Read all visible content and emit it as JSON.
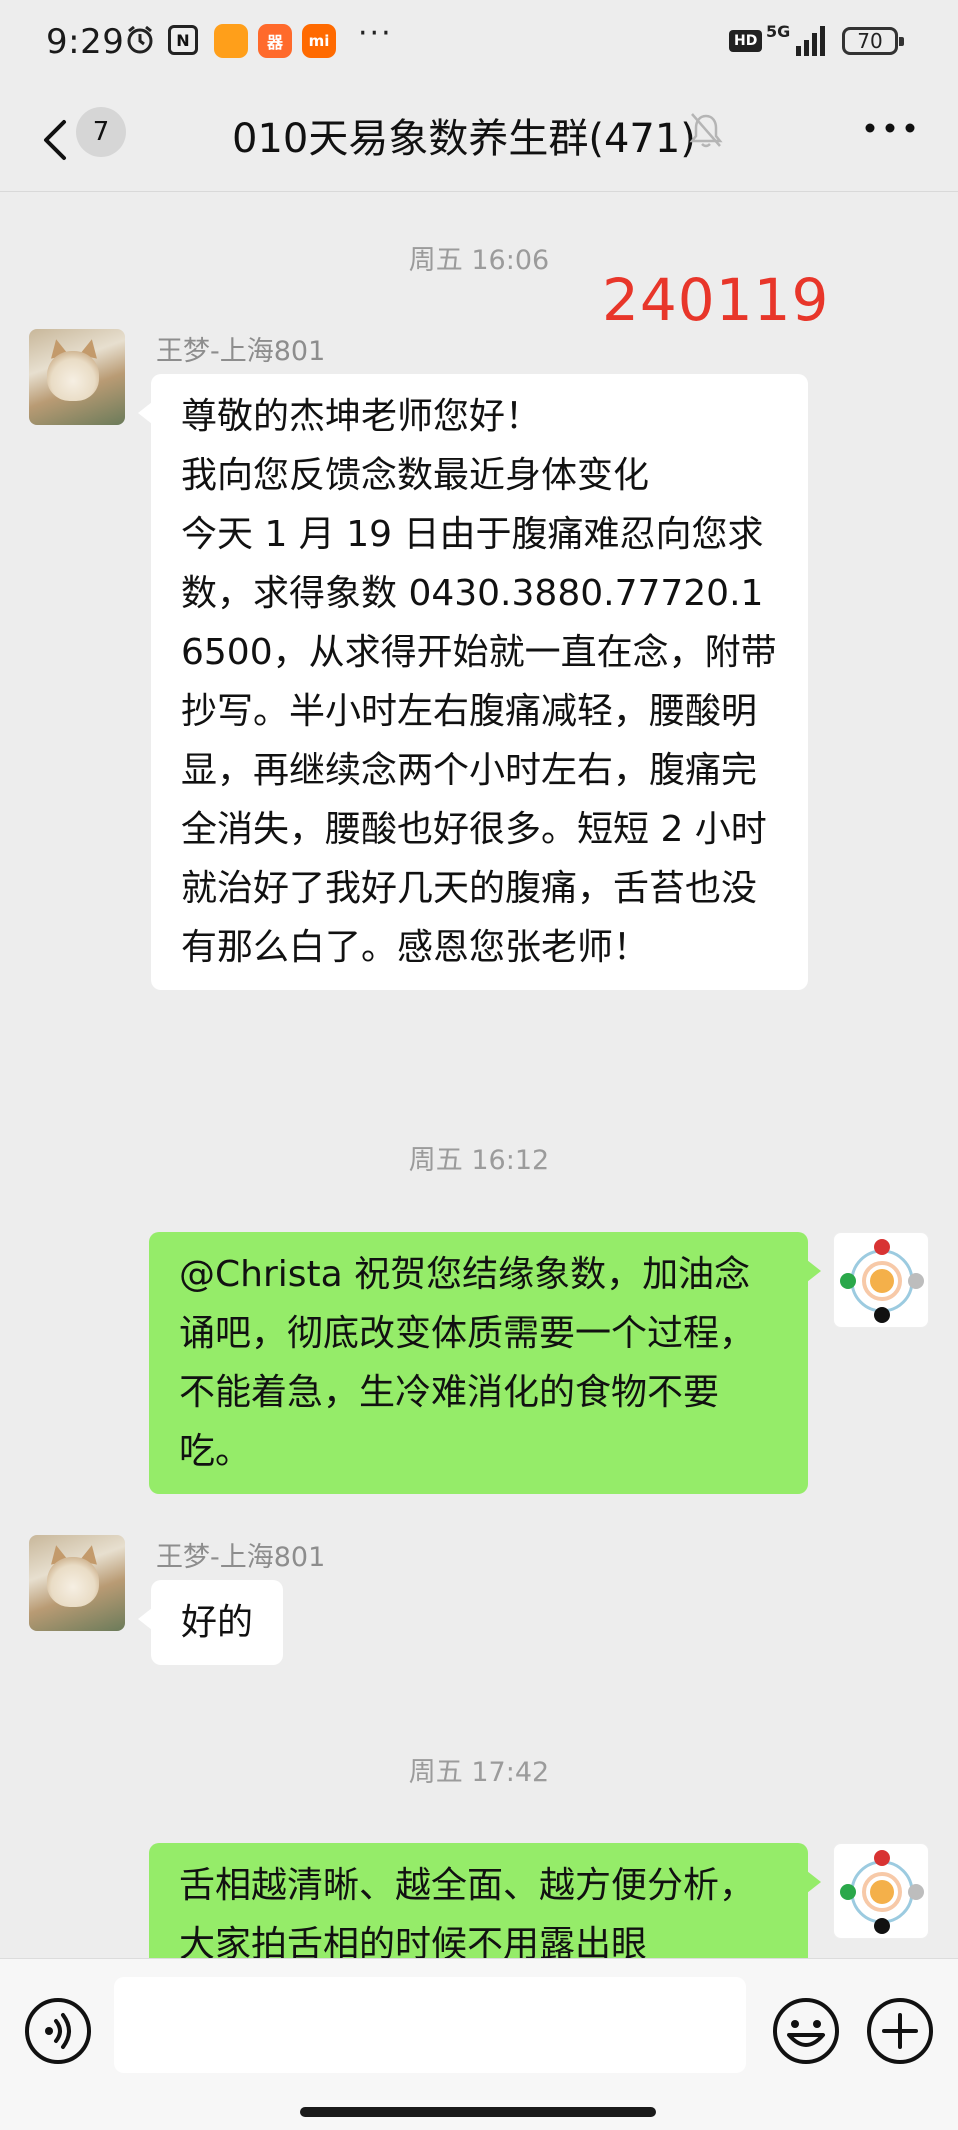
{
  "status_bar": {
    "time": "9:29",
    "app_badges": [
      "",
      "器",
      "mi"
    ],
    "more": "···",
    "hd": "HD",
    "network": "5G",
    "battery": "70"
  },
  "header": {
    "unread_count": "7",
    "title": "010天易象数养生群(471)"
  },
  "messages": [
    {
      "type": "time",
      "text": "周五 16:06"
    },
    {
      "type": "annotation",
      "text": "240119",
      "color": "#e8362a"
    },
    {
      "type": "incoming",
      "sender": "王梦-上海801",
      "text": "尊敬的杰坤老师您好！\n我向您反馈念数最近身体变化\n今天 1 月 19 日由于腹痛难忍向您求数，求得象数 0430.3880.77720.16500，从求得开始就一直在念，附带抄写。半小时左右腹痛减轻，腰酸明显，再继续念两个小时左右，腹痛完全消失，腰酸也好很多。短短 2 小时就治好了我好几天的腹痛，舌苔也没有那么白了。感恩您张老师！"
    },
    {
      "type": "time",
      "text": "周五 16:12"
    },
    {
      "type": "outgoing",
      "text": "@Christa 祝贺您结缘象数，加油念诵吧，彻底改变体质需要一个过程，不能着急，生冷难消化的食物不要吃。"
    },
    {
      "type": "incoming",
      "sender": "王梦-上海801",
      "text": "好的"
    },
    {
      "type": "time",
      "text": "周五 17:42"
    },
    {
      "type": "outgoing",
      "text": "舌相越清晰、越全面、越方便分析，大家拍舌相的时候不用露出眼"
    }
  ],
  "input_bar": {
    "placeholder": ""
  },
  "colors": {
    "outgoing_bubble": "#95ec69",
    "incoming_bubble": "#ffffff",
    "background": "#ededed"
  }
}
